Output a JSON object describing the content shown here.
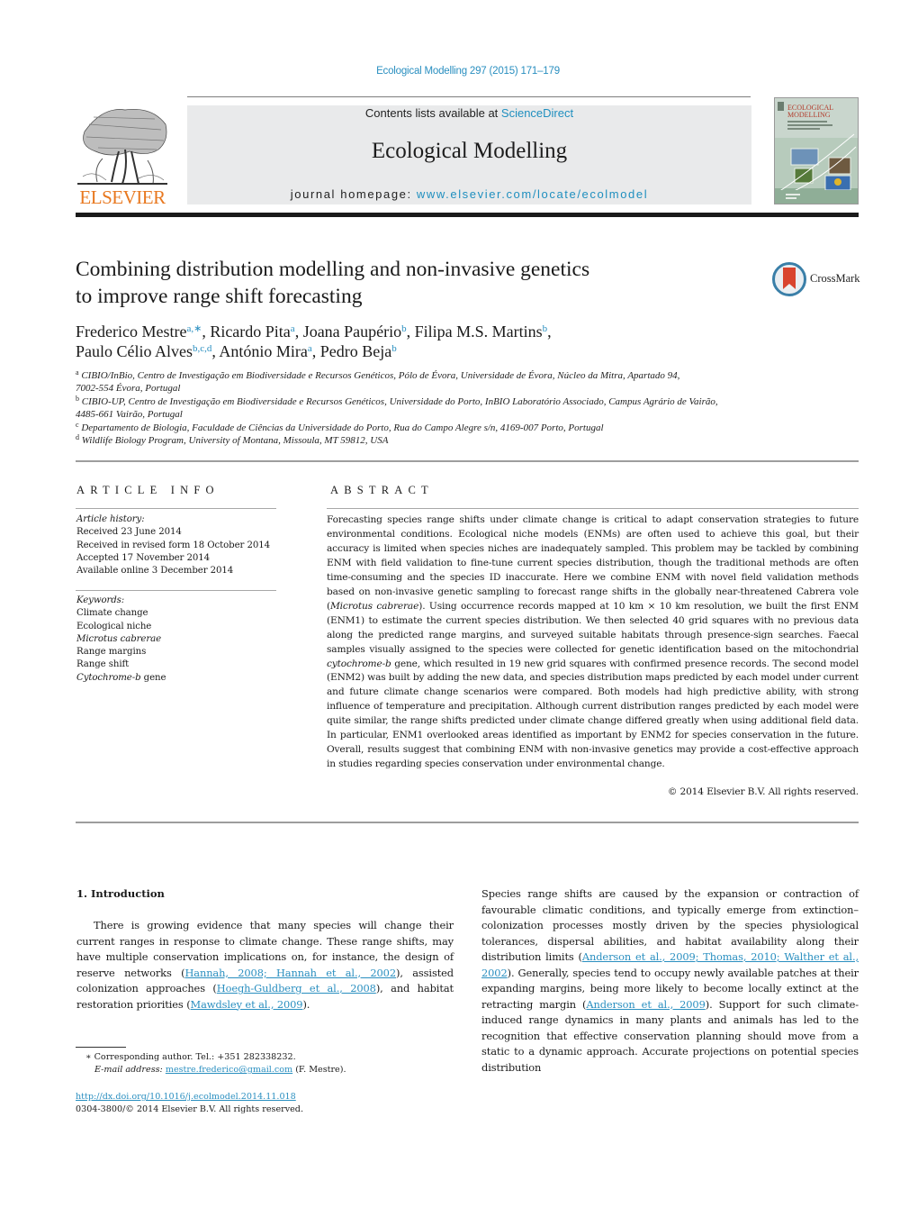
{
  "header": {
    "journal_reference": "Ecological Modelling 297 (2015) 171–179",
    "contents_prefix": "Contents lists available at ",
    "contents_link": "ScienceDirect",
    "journal_name": "Ecological Modelling",
    "homepage_prefix": "journal homepage: ",
    "homepage_link": "www.elsevier.com/locate/ecolmodel",
    "publisher_logo_text": "ELSEVIER",
    "cover_title_line1": "ECOLOGICAL",
    "cover_title_line2": "MODELLING",
    "brand_color": "#e8781f",
    "link_color": "#2a8fc0"
  },
  "article": {
    "title_line1": "Combining distribution modelling and non-invasive genetics",
    "title_line2": "to improve range shift forecasting",
    "crossmark_label": "CrossMark",
    "authors": [
      {
        "name": "Frederico Mestre",
        "sup": "a,∗",
        "sep": ", "
      },
      {
        "name": "Ricardo Pita",
        "sup": "a",
        "sep": ", "
      },
      {
        "name": "Joana Paupério",
        "sup": "b",
        "sep": ", "
      },
      {
        "name": "Filipa M.S. Martins",
        "sup": "b",
        "sep": ","
      },
      {
        "name": "Paulo Célio Alves",
        "sup": "b,c,d",
        "sep": ", "
      },
      {
        "name": "António Mira",
        "sup": "a",
        "sep": ", "
      },
      {
        "name": "Pedro Beja",
        "sup": "b",
        "sep": ""
      }
    ],
    "affiliations": [
      {
        "key": "a",
        "line1": "CIBIO/InBio, Centro de Investigação em Biodiversidade e Recursos Genéticos, Pólo de Évora, Universidade de Évora, Núcleo da Mitra, Apartado 94,",
        "line2": "7002-554 Évora, Portugal"
      },
      {
        "key": "b",
        "line1": "CIBIO-UP, Centro de Investigação em Biodiversidade e Recursos Genéticos, Universidade do Porto, InBIO Laboratório Associado, Campus Agrário de Vairão,",
        "line2": "4485-661 Vairão, Portugal"
      },
      {
        "key": "c",
        "line1": "Departamento de Biologia, Faculdade de Ciências da Universidade do Porto, Rua do Campo Alegre s/n, 4169-007 Porto, Portugal",
        "line2": ""
      },
      {
        "key": "d",
        "line1": "Wildlife Biology Program, University of Montana, Missoula, MT 59812, USA",
        "line2": ""
      }
    ]
  },
  "article_info": {
    "heading": "ARTICLE INFO",
    "history_label": "Article history:",
    "history": [
      "Received 23 June 2014",
      "Received in revised form 18 October 2014",
      "Accepted 17 November 2014",
      "Available online 3 December 2014"
    ],
    "keywords_label": "Keywords:",
    "keywords": [
      {
        "text": "Climate change",
        "italic": false
      },
      {
        "text": "Ecological niche",
        "italic": false
      },
      {
        "text": "Microtus cabrerae",
        "italic": true
      },
      {
        "text": "Range margins",
        "italic": false
      },
      {
        "text": "Range shift",
        "italic": false
      },
      {
        "text": "Cytochrome-b",
        "italic": true,
        "suffix": " gene"
      }
    ]
  },
  "abstract": {
    "heading": "ABSTRACT",
    "part1": "Forecasting species range shifts under climate change is critical to adapt conservation strategies to future environmental conditions. Ecological niche models (ENMs) are often used to achieve this goal, but their accuracy is limited when species niches are inadequately sampled. This problem may be tackled by combining ENM with field validation to fine-tune current species distribution, though the traditional methods are often time-consuming and the species ID inaccurate. Here we combine ENM with novel field validation methods based on non-invasive genetic sampling to forecast range shifts in the globally near-threatened Cabrera vole (",
    "italic1": "Microtus cabrerae",
    "part2": "). Using occurrence records mapped at 10 km × 10 km resolution, we built the first ENM (ENM1) to estimate the current species distribution. We then selected 40 grid squares with no previous data along the predicted range margins, and surveyed suitable habitats through presence-sign searches. Faecal samples visually assigned to the species were collected for genetic identification based on the mitochondrial ",
    "italic2": "cytochrome-b",
    "part3": " gene, which resulted in 19 new grid squares with confirmed presence records. The second model (ENM2) was built by adding the new data, and species distribution maps predicted by each model under current and future climate change scenarios were compared. Both models had high predictive ability, with strong influence of temperature and precipitation. Although current distribution ranges predicted by each model were quite similar, the range shifts predicted under climate change differed greatly when using additional field data. In particular, ENM1 overlooked areas identified as important by ENM2 for species conservation in the future. Overall, results suggest that combining ENM with non-invasive genetics may provide a cost-effective approach in studies regarding species conservation under environmental change.",
    "copyright": "© 2014 Elsevier B.V. All rights reserved."
  },
  "introduction": {
    "heading": "1.  Introduction",
    "left": [
      {
        "t": "There is growing evidence that many species will change their current ranges in response to climate change. These range shifts, may have multiple conservation implications on, for instance, the design of reserve networks ("
      },
      {
        "t": "Hannah, 2008; Hannah et al., 2002",
        "link": true
      },
      {
        "t": "), assisted colonization approaches ("
      },
      {
        "t": "Hoegh-Guldberg et al., 2008",
        "link": true
      },
      {
        "t": "), and habitat restoration priorities ("
      },
      {
        "t": "Mawdsley et al., 2009",
        "link": true
      },
      {
        "t": ")."
      }
    ],
    "right": [
      {
        "t": "Species range shifts are caused by the expansion or contraction of favourable climatic conditions, and typically emerge from extinction–colonization processes mostly driven by the species physiological tolerances, dispersal abilities, and habitat availability along their distribution limits ("
      },
      {
        "t": "Anderson et al., 2009; Thomas, 2010; Walther et al., 2002",
        "link": true
      },
      {
        "t": "). Generally, species tend to occupy newly available patches at their expanding margins, being more likely to become locally extinct at the retracting margin ("
      },
      {
        "t": "Anderson et al., 2009",
        "link": true
      },
      {
        "t": "). Support for such climate-induced range dynamics in many plants and animals has led to the recognition that effective conservation planning should move from a static to a dynamic approach. Accurate projections on potential species distribution"
      }
    ]
  },
  "footnotes": {
    "star": "∗",
    "corresponding": "Corresponding author. Tel.: +351 282338232.",
    "email_label": "E-mail address:",
    "email": "mestre.frederico@gmail.com",
    "email_suffix": " (F. Mestre).",
    "doi": "http://dx.doi.org/10.1016/j.ecolmodel.2014.11.018",
    "issn_copyright": "0304-3800/© 2014 Elsevier B.V. All rights reserved."
  }
}
